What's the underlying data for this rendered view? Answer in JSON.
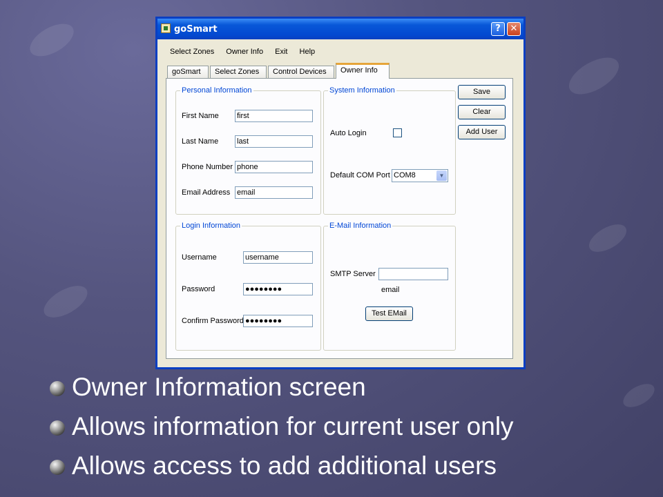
{
  "window": {
    "title": "goSmart",
    "help_glyph": "?",
    "close_glyph": "✕"
  },
  "menu": [
    "Select Zones",
    "Owner Info",
    "Exit",
    "Help"
  ],
  "tabs": [
    {
      "label": "goSmart",
      "active": false
    },
    {
      "label": "Select Zones",
      "active": false
    },
    {
      "label": "Control Devices",
      "active": false
    },
    {
      "label": "Owner Info",
      "active": true
    }
  ],
  "personal": {
    "legend": "Personal Information",
    "first_name_label": "First Name",
    "first_name": "first",
    "last_name_label": "Last Name",
    "last_name": "last",
    "phone_label": "Phone Number",
    "phone": "phone",
    "email_label": "Email Address",
    "email": "email"
  },
  "system": {
    "legend": "System Information",
    "auto_login_label": "Auto Login",
    "auto_login_checked": false,
    "com_port_label": "Default COM Port",
    "com_port": "COM8"
  },
  "login": {
    "legend": "Login Information",
    "username_label": "Username",
    "username": "username",
    "password_label": "Password",
    "password": "●●●●●●●●",
    "confirm_label": "Confirm Password",
    "confirm": "●●●●●●●●"
  },
  "email_info": {
    "legend": "E-Mail Information",
    "smtp_label": "SMTP Server",
    "smtp_value": "",
    "email_text": "email",
    "test_button": "Test EMail"
  },
  "actions": {
    "save": "Save",
    "clear": "Clear",
    "add_user": "Add User"
  },
  "bullets": [
    "Owner Information screen",
    "Allows information for current user only",
    "Allows access to add additional users"
  ],
  "colors": {
    "title_bar": "#0858d8",
    "group_legend": "#0046d5",
    "active_tab_accent": "#e6a53a",
    "slide_bg": "#55557f"
  }
}
